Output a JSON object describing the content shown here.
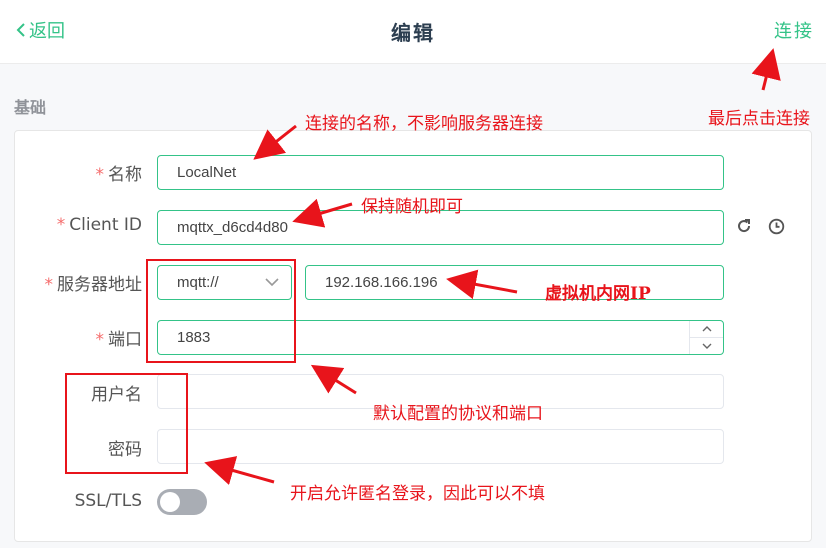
{
  "header": {
    "back_label": "返回",
    "title": "编辑",
    "connect_label": "连接"
  },
  "section_title": "基础",
  "form": {
    "name": {
      "label": "名称",
      "required": "*",
      "value": "LocalNet"
    },
    "client_id": {
      "label": "Client ID",
      "required": "*",
      "value": "mqttx_d6cd4d80"
    },
    "host": {
      "label": "服务器地址",
      "required": "*",
      "protocol": "mqtt://",
      "value": "192.168.166.196"
    },
    "port": {
      "label": "端口",
      "required": "*",
      "value": "1883"
    },
    "username": {
      "label": "用户名",
      "value": ""
    },
    "password": {
      "label": "密码",
      "value": ""
    },
    "ssl": {
      "label": "SSL/TLS",
      "enabled": false
    }
  },
  "annotations": {
    "connect_note": "最后点击连接",
    "name_note": "连接的名称，不影响服务器连接",
    "client_id_note": "保持随机即可",
    "host_note": "虚拟机内网IP",
    "protocol_note": "默认配置的协议和端口",
    "anon_note": "开启允许匿名登录，因此可以不填"
  },
  "colors": {
    "accent": "#34c388",
    "annotation": "#e8141b",
    "required": "#f56c6c"
  },
  "icons": [
    "chevron-left-icon",
    "refresh-icon",
    "clock-icon",
    "chevron-down-icon",
    "caret-up-icon",
    "caret-down-icon"
  ]
}
